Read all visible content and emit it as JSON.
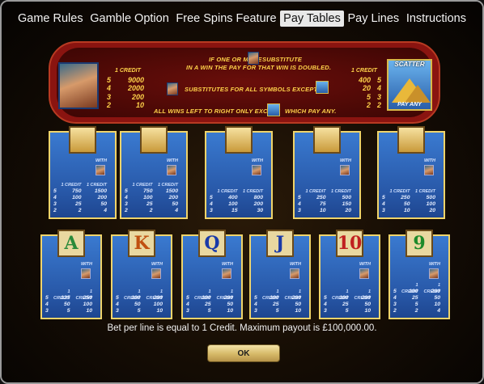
{
  "nav": {
    "tabs": [
      "Game Rules",
      "Gamble Option",
      "Free Spins Feature",
      "Pay Tables",
      "Pay Lines",
      "Instructions"
    ],
    "active": "Pay Tables"
  },
  "banner": {
    "line1": "IF ONE OR MORE",
    "line1b": "SUBSTITUTE",
    "line2": "IN A WIN THE PAY FOR THAT WIN IS DOUBLED.",
    "line3": "SUBSTITUTES FOR ALL SYMBOLS EXCEPT",
    "line4": "ALL WINS LEFT TO RIGHT ONLY EXCEPT",
    "line4b": "WHICH PAY ANY.",
    "left_pay": {
      "header": "1 CREDIT",
      "rows": [
        [
          "5",
          "9000"
        ],
        [
          "4",
          "2000"
        ],
        [
          "3",
          "200"
        ],
        [
          "2",
          "10"
        ]
      ]
    },
    "right_pay": {
      "header": "1 CREDIT",
      "rows": [
        [
          "400",
          "5"
        ],
        [
          "20",
          "4"
        ],
        [
          "5",
          "3"
        ],
        [
          "2",
          "2"
        ]
      ]
    },
    "scatter_label": "SCATTER",
    "pay_any_label": "PAY ANY"
  },
  "cards_row1": [
    {
      "symbol": "mask-icon",
      "glyph": "",
      "with": "WITH",
      "hdr": [
        "1 CREDIT",
        "1 CREDIT"
      ],
      "rows": [
        [
          "5",
          "750",
          "1500"
        ],
        [
          "4",
          "100",
          "200"
        ],
        [
          "3",
          "25",
          "50"
        ],
        [
          "2",
          "2",
          "4"
        ]
      ]
    },
    {
      "symbol": "ring-icon",
      "glyph": "",
      "with": "WITH",
      "hdr": [
        "1 CREDIT",
        "1 CREDIT"
      ],
      "rows": [
        [
          "5",
          "750",
          "1500"
        ],
        [
          "4",
          "100",
          "200"
        ],
        [
          "3",
          "25",
          "50"
        ],
        [
          "2",
          "2",
          "4"
        ]
      ]
    },
    {
      "symbol": "scarab-icon",
      "glyph": "",
      "with": "WITH",
      "hdr": [
        "1 CREDIT",
        "1 CREDIT"
      ],
      "rows": [
        [
          "5",
          "400",
          "800"
        ],
        [
          "4",
          "100",
          "200"
        ],
        [
          "3",
          "15",
          "30"
        ]
      ]
    },
    {
      "symbol": "eye-of-horus-icon",
      "glyph": "",
      "with": "WITH",
      "hdr": [
        "1 CREDIT",
        "1 CREDIT"
      ],
      "rows": [
        [
          "5",
          "250",
          "500"
        ],
        [
          "4",
          "75",
          "150"
        ],
        [
          "3",
          "10",
          "20"
        ]
      ]
    },
    {
      "symbol": "lotus-icon",
      "glyph": "",
      "with": "WITH",
      "hdr": [
        "1 CREDIT",
        "1 CREDIT"
      ],
      "rows": [
        [
          "5",
          "250",
          "500"
        ],
        [
          "4",
          "50",
          "100"
        ],
        [
          "3",
          "10",
          "20"
        ]
      ]
    }
  ],
  "cards_row2": [
    {
      "symbol": "letter-a-icon",
      "glyph": "A",
      "with": "WITH",
      "hdr": [
        "1 CREDIT",
        "1 CREDIT"
      ],
      "rows": [
        [
          "5",
          "125",
          "250"
        ],
        [
          "4",
          "50",
          "100"
        ],
        [
          "3",
          "5",
          "10"
        ]
      ]
    },
    {
      "symbol": "letter-k-icon",
      "glyph": "K",
      "with": "WITH",
      "hdr": [
        "1 CREDIT",
        "1 CREDIT"
      ],
      "rows": [
        [
          "5",
          "100",
          "200"
        ],
        [
          "4",
          "50",
          "100"
        ],
        [
          "3",
          "5",
          "10"
        ]
      ]
    },
    {
      "symbol": "letter-q-icon",
      "glyph": "Q",
      "with": "WITH",
      "hdr": [
        "1 CREDIT",
        "1 CREDIT"
      ],
      "rows": [
        [
          "5",
          "100",
          "200"
        ],
        [
          "4",
          "25",
          "50"
        ],
        [
          "3",
          "5",
          "10"
        ]
      ]
    },
    {
      "symbol": "letter-j-icon",
      "glyph": "J",
      "with": "WITH",
      "hdr": [
        "1 CREDIT",
        "1 CREDIT"
      ],
      "rows": [
        [
          "5",
          "100",
          "200"
        ],
        [
          "4",
          "25",
          "50"
        ],
        [
          "3",
          "5",
          "10"
        ]
      ]
    },
    {
      "symbol": "number-10-icon",
      "glyph": "10",
      "with": "WITH",
      "hdr": [
        "1 CREDIT",
        "1 CREDIT"
      ],
      "rows": [
        [
          "5",
          "100",
          "200"
        ],
        [
          "4",
          "25",
          "50"
        ],
        [
          "3",
          "5",
          "10"
        ]
      ]
    },
    {
      "symbol": "number-9-icon",
      "glyph": "9",
      "with": "WITH",
      "hdr": [
        "1 CREDIT",
        "1 CREDIT"
      ],
      "rows": [
        [
          "5",
          "100",
          "200"
        ],
        [
          "4",
          "25",
          "50"
        ],
        [
          "3",
          "5",
          "10"
        ],
        [
          "2",
          "2",
          "4"
        ]
      ]
    }
  ],
  "footer_text": "Bet per line is equal to 1 Credit.  Maximum payout is £100,000.00.",
  "ok_label": "OK",
  "colors": {
    "card_border": "#f0d46a",
    "card_bg": "#2858a8",
    "gold_text": "#ffd24a",
    "banner_bg": "#8a1410"
  }
}
